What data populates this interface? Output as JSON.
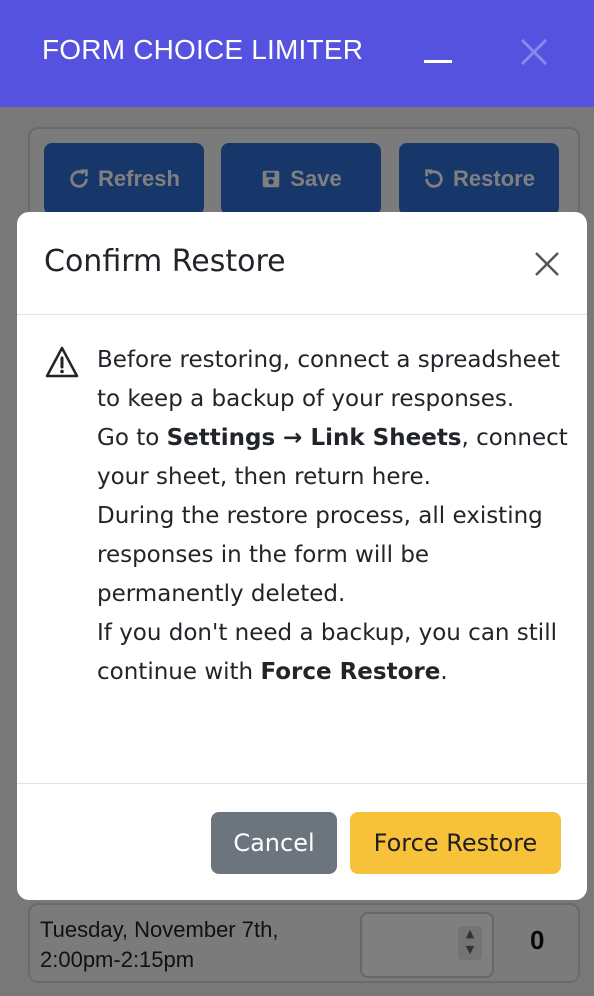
{
  "window": {
    "title": "FORM CHOICE LIMITER",
    "minimize_icon": "minimize-icon",
    "close_icon": "close-icon"
  },
  "toolbar": {
    "refresh_label": "Refresh",
    "save_label": "Save",
    "restore_label": "Restore"
  },
  "slot_row": {
    "date_line1": "Tuesday, November 7th,",
    "date_line2": "2:00pm-2:15pm",
    "count": "0"
  },
  "modal": {
    "title": "Confirm Restore",
    "body": {
      "p1": "Before restoring, connect a spreadsheet to keep a backup of your responses.",
      "p2_prefix": "Go to ",
      "p2_bold": "Settings → Link Sheets",
      "p2_suffix": ", connect your sheet, then return here.",
      "p3": "During the restore process, all existing responses in the form will be permanently deleted.",
      "p4_prefix": "If you don't need a backup, you can still continue with ",
      "p4_bold": "Force Restore",
      "p4_suffix": "."
    },
    "cancel_label": "Cancel",
    "force_restore_label": "Force Restore"
  },
  "colors": {
    "titlebar": "#5552e0",
    "primary_button": "#2f6fd6",
    "cancel_button": "#6c757d",
    "force_button": "#f8c13a"
  }
}
